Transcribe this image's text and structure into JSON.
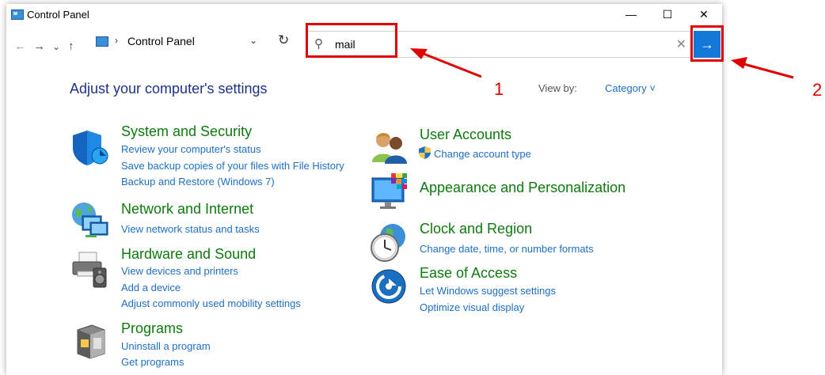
{
  "window": {
    "title": "Control Panel",
    "controls": {
      "minimize": "—",
      "maximize": "☐",
      "close": "✕"
    }
  },
  "navigation": {
    "back": "←",
    "forward": "→",
    "recent": "⌄",
    "up": "↑",
    "address_separator": "›",
    "address": "Control Panel",
    "address_dropdown": "⌄",
    "refresh": "↻"
  },
  "search": {
    "value": "mail",
    "magnifier": "⚲",
    "clear": "✕",
    "go": "→"
  },
  "main": {
    "title": "Adjust your computer's settings",
    "view_by_label": "View by:",
    "view_by_value": "Category ˅"
  },
  "categories_left": [
    {
      "title": "System and Security",
      "icon": "shield-icon",
      "links": [
        "Review your computer's status",
        "Save backup copies of your files with File History",
        "Backup and Restore (Windows 7)"
      ]
    },
    {
      "title": "Network and Internet",
      "icon": "globe-network-icon",
      "links": [
        "View network status and tasks"
      ]
    },
    {
      "title": "Hardware and Sound",
      "icon": "printer-speaker-icon",
      "links": [
        "View devices and printers",
        "Add a device",
        "Adjust commonly used mobility settings"
      ]
    },
    {
      "title": "Programs",
      "icon": "programs-icon",
      "links": [
        "Uninstall a program",
        "Get programs"
      ]
    }
  ],
  "categories_right": [
    {
      "title": "User Accounts",
      "icon": "users-icon",
      "links": [
        "Change account type"
      ]
    },
    {
      "title": "Appearance and Personalization",
      "icon": "monitor-palette-icon",
      "links": []
    },
    {
      "title": "Clock and Region",
      "icon": "clock-globe-icon",
      "links": [
        "Change date, time, or number formats"
      ]
    },
    {
      "title": "Ease of Access",
      "icon": "ease-of-access-icon",
      "links": [
        "Let Windows suggest settings",
        "Optimize visual display"
      ]
    }
  ],
  "annotations": {
    "label_1": "1",
    "label_2": "2"
  },
  "colors": {
    "category_title": "#0e7a0e",
    "link": "#1e6fc4",
    "heading": "#1e3287",
    "accent": "#1478d8",
    "annotation": "#e00000"
  }
}
